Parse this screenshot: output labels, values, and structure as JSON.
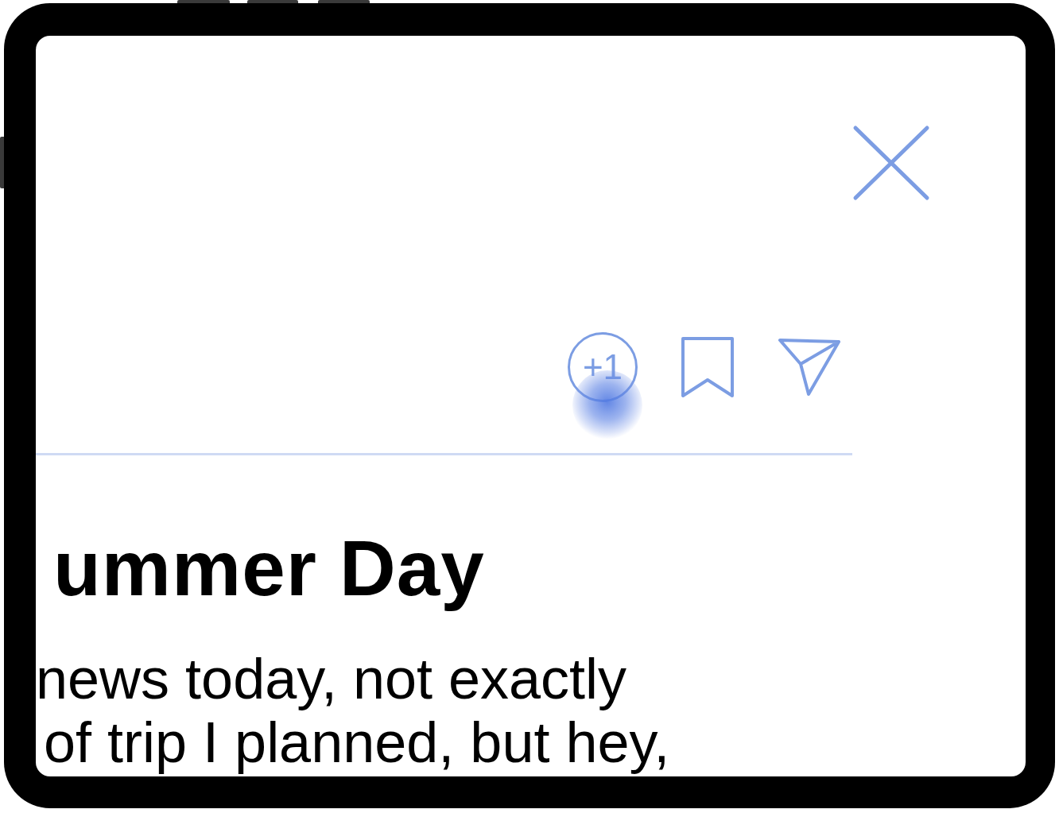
{
  "actions": [
    {
      "kind": "plus_one",
      "label": "+1",
      "pressed": true
    },
    {
      "kind": "bookmark",
      "pressed": false
    },
    {
      "kind": "send",
      "pressed": false
    }
  ],
  "article": {
    "title": "ummer Day",
    "body_lines": [
      "news today, not exactly",
      "of trip I planned, but hey,"
    ]
  }
}
